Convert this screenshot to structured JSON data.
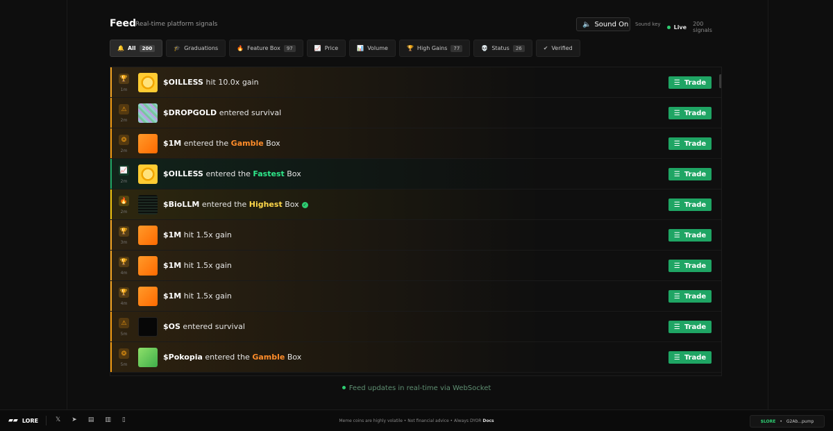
{
  "header": {
    "title": "Feed",
    "subtitle": "Real-time platform signals",
    "sound_label": "Sound On",
    "sound_key": "Sound key",
    "live_label": "Live",
    "signals_count": "200 signals"
  },
  "tabs": [
    {
      "label": "All",
      "badge": "200",
      "icon": "bell-icon",
      "glyph": "🔔",
      "active": true
    },
    {
      "label": "Graduations",
      "badge": "",
      "icon": "graduation-cap-icon",
      "glyph": "🎓"
    },
    {
      "label": "Feature Box",
      "badge": "97",
      "icon": "flame-icon",
      "glyph": "🔥"
    },
    {
      "label": "Price",
      "badge": "",
      "icon": "line-chart-icon",
      "glyph": "📈"
    },
    {
      "label": "Volume",
      "badge": "",
      "icon": "bar-chart-icon",
      "glyph": "📊"
    },
    {
      "label": "High Gains",
      "badge": "77",
      "icon": "trophy-icon",
      "glyph": "🏆"
    },
    {
      "label": "Status",
      "badge": "26",
      "icon": "skull-icon",
      "glyph": "💀"
    },
    {
      "label": "Verified",
      "badge": "",
      "icon": "verified-icon",
      "glyph": "✔"
    }
  ],
  "feed": [
    {
      "type": "gain",
      "icon": "trophy-icon",
      "time": "1m",
      "ticker": "$OILLESS",
      "text": " hit 10.0x gain",
      "box": "",
      "box_suffix": "",
      "verified": false,
      "accent": "#f5a623",
      "avatar": "coin-gold"
    },
    {
      "type": "survival",
      "icon": "warning-icon",
      "time": "2m",
      "ticker": "$DROPGOLD",
      "text": " entered survival",
      "box": "",
      "box_suffix": "",
      "verified": false,
      "accent": "#f39c12",
      "avatar": "glitter"
    },
    {
      "type": "box",
      "icon": "gamble-icon",
      "time": "2m",
      "ticker": "$1M",
      "text": " entered the ",
      "box": "Gamble",
      "box_suffix": " Box",
      "verified": false,
      "accent": "#f39c12",
      "box_color": "#ff8c2a",
      "avatar": "orange"
    },
    {
      "type": "box",
      "icon": "chart-up-icon",
      "time": "2m",
      "ticker": "$OILLESS",
      "text": " entered the ",
      "box": "Fastest",
      "box_suffix": " Box",
      "verified": false,
      "accent": "#1fa564",
      "box_color": "#2ee88a",
      "avatar": "coin-gold"
    },
    {
      "type": "box",
      "icon": "flame-icon",
      "time": "2m",
      "ticker": "$BioLLM",
      "text": " entered the ",
      "box": "Highest",
      "box_suffix": " Box",
      "verified": true,
      "accent": "#f1c40f",
      "box_color": "#ffd84a",
      "avatar": "dark-grid"
    },
    {
      "type": "gain",
      "icon": "trophy-icon",
      "time": "3m",
      "ticker": "$1M",
      "text": " hit 1.5x gain",
      "box": "",
      "box_suffix": "",
      "verified": false,
      "accent": "#f5a623",
      "avatar": "orange"
    },
    {
      "type": "gain",
      "icon": "trophy-icon",
      "time": "4m",
      "ticker": "$1M",
      "text": " hit 1.5x gain",
      "box": "",
      "box_suffix": "",
      "verified": false,
      "accent": "#f5a623",
      "avatar": "orange"
    },
    {
      "type": "gain",
      "icon": "trophy-icon",
      "time": "4m",
      "ticker": "$1M",
      "text": " hit 1.5x gain",
      "box": "",
      "box_suffix": "",
      "verified": false,
      "accent": "#f5a623",
      "avatar": "orange"
    },
    {
      "type": "survival",
      "icon": "warning-icon",
      "time": "5m",
      "ticker": "$OS",
      "text": " entered survival",
      "box": "",
      "box_suffix": "",
      "verified": false,
      "accent": "#f39c12",
      "avatar": "dark"
    },
    {
      "type": "box",
      "icon": "gamble-icon",
      "time": "5m",
      "ticker": "$Pokopia",
      "text": " entered the ",
      "box": "Gamble",
      "box_suffix": " Box",
      "verified": false,
      "accent": "#f39c12",
      "box_color": "#ff8c2a",
      "avatar": "green"
    }
  ],
  "trade_label": "Trade",
  "ws_note": "Feed updates in real-time via WebSocket",
  "footer": {
    "brand": "LORE",
    "disclaimer": "Meme coins are highly volatile • Not financial advice • Always DYOR",
    "docs": "Docs",
    "token": "$LORE",
    "address": "G2Ab...pump",
    "icons": [
      "x-icon",
      "telegram-icon",
      "book-icon",
      "chart-icon",
      "document-icon"
    ]
  }
}
